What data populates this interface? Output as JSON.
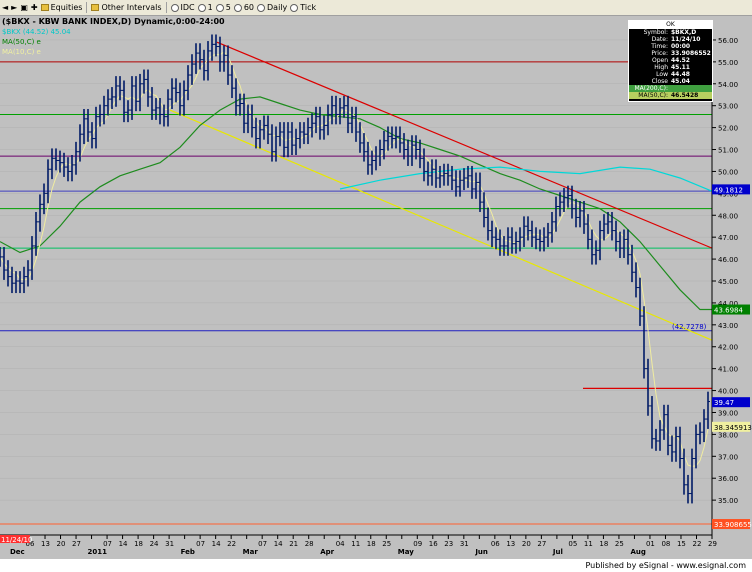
{
  "toolbar": {
    "items": [
      "Equities",
      "Other Intervals",
      "IDC",
      "1",
      "5",
      "60",
      "Daily",
      "Tick"
    ]
  },
  "window_title": "($BKX - KBW BANK INDEX,D) Dynamic,0:00-24:00",
  "footer_text": "Published by eSignal - www.esignal.com",
  "data_window": {
    "header": "OK",
    "rows": [
      {
        "label": "Symbol:",
        "value": "$BKX,D"
      },
      {
        "label": "Date:",
        "value": "11/24/10"
      },
      {
        "label": "Time:",
        "value": "00:00"
      },
      {
        "label": "Price:",
        "value": "33.9086552"
      },
      {
        "label": "Open",
        "value": "44.52"
      },
      {
        "label": "High",
        "value": "45.11"
      },
      {
        "label": "Low",
        "value": "44.48"
      },
      {
        "label": "Close",
        "value": "45.04"
      }
    ],
    "ma200": {
      "label": "MA(200,C):",
      "value": ""
    },
    "ma50": {
      "label": "MA(50,C):",
      "value": "46.5428"
    }
  },
  "legend": [
    {
      "text": "$BKX (44.52) 45.04",
      "color": "#00c8c8"
    },
    {
      "text": "MA(50,C) e",
      "color": "#008000"
    },
    {
      "text": "MA(10,C) e",
      "color": "#f0f0a0"
    }
  ],
  "colors": {
    "background": "#c0c0c0",
    "bar": "#001a66",
    "ma50": "#1e8c1e",
    "ma10": "#f0eca0",
    "ma200": "#00d8d8",
    "resistance": "#dc0000",
    "support": "#f0f000"
  },
  "chart_data": {
    "type": "bar",
    "symbol": "$BKX",
    "ylim": [
      33.5,
      56.5
    ],
    "y_ticks": [
      35.0,
      36.0,
      37.0,
      38.0,
      39.0,
      40.0,
      41.0,
      42.0,
      43.0,
      44.0,
      45.0,
      46.0,
      47.0,
      48.0,
      49.0,
      50.0,
      51.0,
      52.0,
      53.0,
      54.0,
      55.0,
      56.0
    ],
    "x_tick_labels": [
      "Dec",
      "06",
      "13",
      "20",
      "27",
      "2011",
      "07",
      "14",
      "18",
      "24",
      "31",
      "Feb",
      "07",
      "14",
      "22",
      "Mar",
      "07",
      "14",
      "21",
      "28",
      "Apr",
      "04",
      "11",
      "18",
      "25",
      "May",
      "09",
      "16",
      "23",
      "31",
      "Jun",
      "06",
      "13",
      "20",
      "27",
      "Jul",
      "05",
      "11",
      "18",
      "25",
      "Aug",
      "01",
      "08",
      "15",
      "22",
      "29"
    ],
    "x_ticks_month": [
      "Dec",
      "2011",
      "Feb",
      "Mar",
      "Apr",
      "May",
      "Jun",
      "Jul",
      "Aug"
    ],
    "x_ticks_day": [
      "06",
      "13",
      "20",
      "27",
      "10",
      "18",
      "24",
      "31",
      "07",
      "14",
      "22",
      "28",
      "07",
      "14",
      "21",
      "28",
      "04",
      "11",
      "18",
      "25",
      "02",
      "09",
      "16",
      "23",
      "31",
      "06",
      "13",
      "20",
      "27",
      "05",
      "11",
      "18",
      "25",
      "01",
      "08",
      "15",
      "22",
      "29"
    ],
    "price_points": [
      [
        0,
        46.1
      ],
      [
        4,
        45.5
      ],
      [
        8,
        45.2
      ],
      [
        12,
        44.9
      ],
      [
        16,
        45.0
      ],
      [
        20,
        44.9
      ],
      [
        24,
        45.2
      ],
      [
        28,
        45.5
      ],
      [
        32,
        46.6
      ],
      [
        36,
        47.7
      ],
      [
        40,
        48.5
      ],
      [
        44,
        49.0
      ],
      [
        48,
        50.1
      ],
      [
        52,
        50.6
      ],
      [
        56,
        50.5
      ],
      [
        60,
        50.4
      ],
      [
        64,
        50.2
      ],
      [
        68,
        50.0
      ],
      [
        72,
        50.3
      ],
      [
        76,
        50.9
      ],
      [
        80,
        51.7
      ],
      [
        84,
        52.4
      ],
      [
        88,
        51.8
      ],
      [
        92,
        51.5
      ],
      [
        96,
        52.5
      ],
      [
        100,
        52.6
      ],
      [
        104,
        53.0
      ],
      [
        108,
        53.3
      ],
      [
        112,
        53.4
      ],
      [
        116,
        53.9
      ],
      [
        120,
        53.7
      ],
      [
        124,
        52.7
      ],
      [
        128,
        52.8
      ],
      [
        132,
        53.9
      ],
      [
        136,
        53.2
      ],
      [
        140,
        54.0
      ],
      [
        144,
        54.2
      ],
      [
        148,
        53.4
      ],
      [
        152,
        52.8
      ],
      [
        156,
        52.9
      ],
      [
        160,
        52.6
      ],
      [
        164,
        52.5
      ],
      [
        168,
        53.3
      ],
      [
        172,
        53.8
      ],
      [
        176,
        53.6
      ],
      [
        180,
        53.0
      ],
      [
        184,
        53.7
      ],
      [
        188,
        54.4
      ],
      [
        192,
        54.9
      ],
      [
        196,
        55.4
      ],
      [
        200,
        55.1
      ],
      [
        204,
        54.6
      ],
      [
        208,
        55.5
      ],
      [
        212,
        55.8
      ],
      [
        216,
        55.7
      ],
      [
        220,
        55.0
      ],
      [
        224,
        55.3
      ],
      [
        228,
        54.4
      ],
      [
        232,
        53.8
      ],
      [
        236,
        53.0
      ],
      [
        240,
        53.1
      ],
      [
        244,
        52.2
      ],
      [
        248,
        52.6
      ],
      [
        252,
        52.0
      ],
      [
        256,
        51.5
      ],
      [
        260,
        51.9
      ],
      [
        264,
        52.1
      ],
      [
        268,
        51.7
      ],
      [
        272,
        50.9
      ],
      [
        276,
        51.6
      ],
      [
        280,
        51.8
      ],
      [
        284,
        51.1
      ],
      [
        288,
        51.8
      ],
      [
        292,
        51.2
      ],
      [
        296,
        51.5
      ],
      [
        300,
        51.8
      ],
      [
        304,
        51.7
      ],
      [
        308,
        52.0
      ],
      [
        312,
        52.2
      ],
      [
        316,
        52.5
      ],
      [
        320,
        51.9
      ],
      [
        324,
        52.1
      ],
      [
        328,
        52.6
      ],
      [
        332,
        53.0
      ],
      [
        336,
        52.6
      ],
      [
        340,
        52.9
      ],
      [
        344,
        53.0
      ],
      [
        348,
        52.2
      ],
      [
        352,
        52.5
      ],
      [
        356,
        51.8
      ],
      [
        360,
        51.3
      ],
      [
        364,
        50.9
      ],
      [
        368,
        50.3
      ],
      [
        372,
        50.5
      ],
      [
        376,
        50.7
      ],
      [
        380,
        51.0
      ],
      [
        384,
        51.4
      ],
      [
        388,
        51.6
      ],
      [
        392,
        51.5
      ],
      [
        396,
        51.6
      ],
      [
        400,
        51.3
      ],
      [
        404,
        51.0
      ],
      [
        408,
        50.7
      ],
      [
        412,
        51.2
      ],
      [
        416,
        51.0
      ],
      [
        420,
        50.6
      ],
      [
        424,
        50.0
      ],
      [
        428,
        49.8
      ],
      [
        432,
        50.1
      ],
      [
        436,
        49.7
      ],
      [
        440,
        49.8
      ],
      [
        444,
        49.9
      ],
      [
        448,
        49.8
      ],
      [
        452,
        49.6
      ],
      [
        456,
        49.3
      ],
      [
        460,
        49.6
      ],
      [
        464,
        49.7
      ],
      [
        468,
        49.8
      ],
      [
        472,
        49.2
      ],
      [
        476,
        49.5
      ],
      [
        480,
        48.6
      ],
      [
        484,
        47.9
      ],
      [
        488,
        47.3
      ],
      [
        492,
        47.0
      ],
      [
        496,
        46.9
      ],
      [
        500,
        46.6
      ],
      [
        504,
        46.6
      ],
      [
        508,
        47.0
      ],
      [
        512,
        46.7
      ],
      [
        516,
        46.8
      ],
      [
        520,
        47.0
      ],
      [
        524,
        47.5
      ],
      [
        528,
        47.3
      ],
      [
        532,
        47.0
      ],
      [
        536,
        46.9
      ],
      [
        540,
        46.8
      ],
      [
        544,
        47.0
      ],
      [
        548,
        47.2
      ],
      [
        552,
        47.7
      ],
      [
        556,
        48.4
      ],
      [
        560,
        48.6
      ],
      [
        564,
        48.8
      ],
      [
        568,
        48.9
      ],
      [
        572,
        48.3
      ],
      [
        576,
        47.9
      ],
      [
        580,
        48.2
      ],
      [
        584,
        47.6
      ],
      [
        588,
        46.9
      ],
      [
        592,
        46.2
      ],
      [
        596,
        46.4
      ],
      [
        600,
        47.3
      ],
      [
        604,
        47.6
      ],
      [
        608,
        47.7
      ],
      [
        612,
        47.3
      ],
      [
        616,
        46.8
      ],
      [
        620,
        46.5
      ],
      [
        624,
        46.9
      ],
      [
        628,
        46.2
      ],
      [
        632,
        45.4
      ],
      [
        636,
        44.7
      ],
      [
        640,
        43.4
      ],
      [
        644,
        41.0
      ],
      [
        648,
        39.3
      ],
      [
        652,
        37.8
      ],
      [
        656,
        37.7
      ],
      [
        660,
        38.2
      ],
      [
        664,
        38.9
      ],
      [
        668,
        37.5
      ],
      [
        672,
        37.2
      ],
      [
        676,
        37.9
      ],
      [
        680,
        36.9
      ],
      [
        684,
        35.7
      ],
      [
        688,
        35.3
      ],
      [
        692,
        36.9
      ],
      [
        696,
        38.0
      ],
      [
        700,
        38.1
      ],
      [
        704,
        38.7
      ],
      [
        708,
        39.5
      ]
    ],
    "series": [
      {
        "name": "MA(50,C)",
        "color": "#1e8c1e",
        "points": [
          [
            0,
            46.8
          ],
          [
            20,
            46.3
          ],
          [
            40,
            46.6
          ],
          [
            60,
            47.5
          ],
          [
            80,
            48.6
          ],
          [
            100,
            49.3
          ],
          [
            120,
            49.8
          ],
          [
            140,
            50.1
          ],
          [
            160,
            50.4
          ],
          [
            180,
            51.1
          ],
          [
            200,
            52.1
          ],
          [
            220,
            52.8
          ],
          [
            240,
            53.3
          ],
          [
            260,
            53.4
          ],
          [
            280,
            53.1
          ],
          [
            300,
            52.8
          ],
          [
            320,
            52.6
          ],
          [
            340,
            52.5
          ],
          [
            360,
            52.4
          ],
          [
            380,
            52.0
          ],
          [
            400,
            51.5
          ],
          [
            420,
            51.3
          ],
          [
            440,
            51.0
          ],
          [
            460,
            50.7
          ],
          [
            480,
            50.3
          ],
          [
            500,
            49.9
          ],
          [
            520,
            49.6
          ],
          [
            540,
            49.2
          ],
          [
            560,
            48.9
          ],
          [
            580,
            48.6
          ],
          [
            600,
            48.3
          ],
          [
            620,
            47.7
          ],
          [
            640,
            46.8
          ],
          [
            660,
            45.7
          ],
          [
            680,
            44.6
          ],
          [
            700,
            43.7
          ],
          [
            712,
            43.6984
          ]
        ]
      },
      {
        "name": "MA(200,C)",
        "color": "#00d8d8",
        "points": [
          [
            340,
            49.2
          ],
          [
            380,
            49.6
          ],
          [
            420,
            49.9
          ],
          [
            460,
            50.1
          ],
          [
            500,
            50.2
          ],
          [
            540,
            50.0
          ],
          [
            580,
            49.9
          ],
          [
            620,
            50.2
          ],
          [
            650,
            50.1
          ],
          [
            680,
            49.7
          ],
          [
            712,
            49.1
          ]
        ]
      }
    ],
    "horizontal_lines": [
      {
        "y": 55.0,
        "color": "#b00000"
      },
      {
        "y": 52.6,
        "color": "#00a000"
      },
      {
        "y": 50.7,
        "color": "#6a006a"
      },
      {
        "y": 49.1,
        "color": "#4040c0"
      },
      {
        "y": 48.3,
        "color": "#00a000"
      },
      {
        "y": 46.5,
        "color": "#00c060"
      },
      {
        "y": 42.7278,
        "color": "#2020c0"
      },
      {
        "y": 33.9086655,
        "color": "#ff6030"
      }
    ],
    "trend_lines": [
      {
        "name": "resistance",
        "color": "#dc0000",
        "x": [
          217,
          712
        ],
        "y": [
          55.9,
          46.5
        ]
      },
      {
        "name": "support",
        "color": "#e8e800",
        "x": [
          170,
          712
        ],
        "y": [
          52.8,
          42.3
        ]
      },
      {
        "name": "resistance-short",
        "color": "#dc0000",
        "x": [
          583,
          712
        ],
        "y": [
          40.1,
          40.1
        ]
      }
    ],
    "price_labels": [
      {
        "text": "49.1812",
        "y": 49.1812,
        "bg": "#0000cc",
        "fg": "#ffffff"
      },
      {
        "text": "43.6984",
        "y": 43.6984,
        "bg": "#008000",
        "fg": "#ffffff"
      },
      {
        "text": "39.47",
        "y": 39.47,
        "bg": "#0000cc",
        "fg": "#ffffff"
      },
      {
        "text": "38.345913",
        "y": 38.345913,
        "bg": "#f0f0a0",
        "fg": "#000000"
      },
      {
        "text": "33.908655",
        "y": 33.908655,
        "bg": "#ff5020",
        "fg": "#ffffff"
      }
    ],
    "annotations": [
      {
        "text": "(42.7278)",
        "y": 42.7278,
        "color": "#0000cc"
      }
    ],
    "date_label": "11/24/10"
  }
}
